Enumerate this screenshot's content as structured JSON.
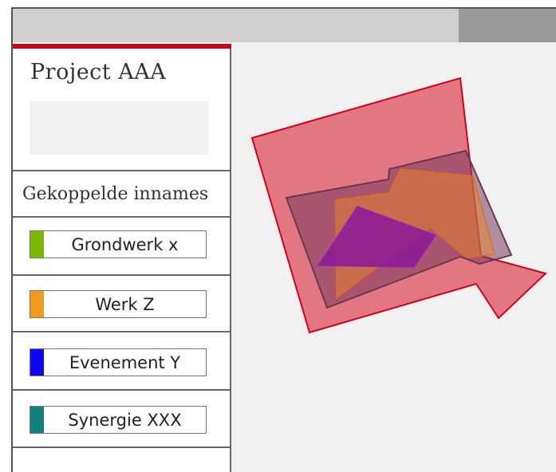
{
  "project": {
    "title": "Project AAA"
  },
  "panel": {
    "section_title": "Gekoppelde innames",
    "items": [
      {
        "label": "Grondwerk x",
        "color": "#7ab800"
      },
      {
        "label": "Werk Z",
        "color": "#f39a1e"
      },
      {
        "label": "Evenement Y",
        "color": "#0a0af0"
      },
      {
        "label": "Synergie XXX",
        "color": "#128080"
      }
    ]
  },
  "colors": {
    "accent": "#d0021b",
    "project_area": "#e06070",
    "overlap_dark": "#8a3a5a",
    "orange_area": "#e07a3a",
    "purple_area": "#8a1a9a"
  }
}
